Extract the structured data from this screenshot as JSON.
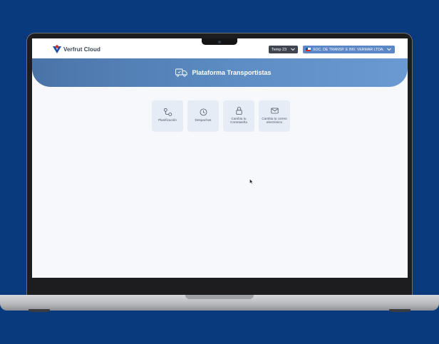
{
  "app": {
    "brand": "Verfrut Cloud",
    "season_label": "Temp 23",
    "company_label": "SOC. DE TRANSP. E INV. VERMAR LTDA.",
    "platform_title": "Plataforma Transportistas"
  },
  "tiles": [
    {
      "label": "Planificación",
      "icon": "route-icon"
    },
    {
      "label": "Despachos",
      "icon": "clock-icon"
    },
    {
      "label": "Cambia tu Contraseña",
      "icon": "lock-icon"
    },
    {
      "label": "Cambia tu correo electrónico",
      "icon": "mail-icon"
    }
  ],
  "colors": {
    "background": "#0a3a7e",
    "banner": "#5d8dc4",
    "company_select": "#5c87c6",
    "season_select": "#3f4650",
    "tile": "#e6ecf5"
  }
}
